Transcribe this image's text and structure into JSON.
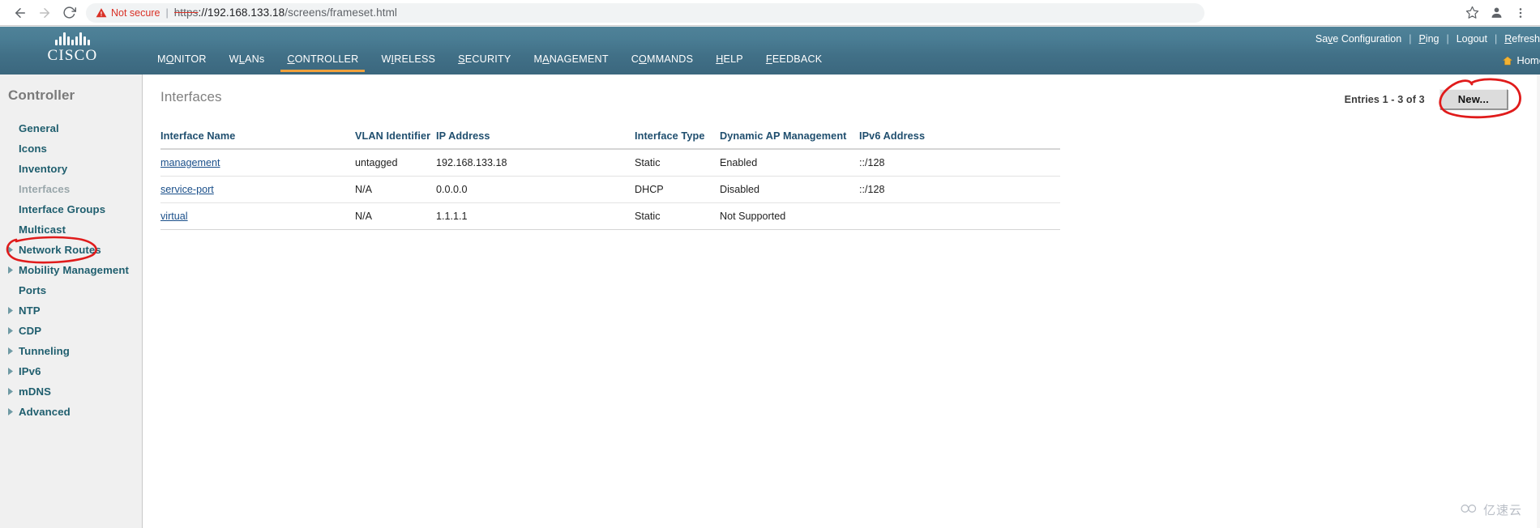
{
  "browser": {
    "back_icon": "back-arrow-icon",
    "forward_icon": "forward-arrow-icon",
    "reload_icon": "reload-icon",
    "warning_label": "Not secure",
    "separator": "|",
    "url_scheme": "https",
    "url_rest": "://192.168.133.18/screens/frameset.html",
    "url_scheme_struck": "https",
    "url_host": "://192.168.133.18",
    "url_path": "/screens/frameset.html",
    "bookmark_icon": "star-icon",
    "profile_icon": "profile-avatar-icon",
    "menu_icon": "kebab-menu-icon"
  },
  "header": {
    "brand": "CISCO",
    "nav": [
      {
        "label": "MONITOR",
        "accesskey": "O",
        "active": false
      },
      {
        "label": "WLANs",
        "accesskey": "L",
        "active": false
      },
      {
        "label": "CONTROLLER",
        "accesskey": "C",
        "active": true
      },
      {
        "label": "WIRELESS",
        "accesskey": "W",
        "active": false
      },
      {
        "label": "SECURITY",
        "accesskey": "S",
        "active": false
      },
      {
        "label": "MANAGEMENT",
        "accesskey": "A",
        "active": false
      },
      {
        "label": "COMMANDS",
        "accesskey": "O",
        "active": false
      },
      {
        "label": "HELP",
        "accesskey": "H",
        "active": false
      },
      {
        "label": "FEEDBACK",
        "accesskey": "F",
        "active": false
      }
    ],
    "links": [
      {
        "label": "Save Configuration",
        "accesskey": "v"
      },
      {
        "label": "Ping",
        "accesskey": "P"
      },
      {
        "label": "Logout",
        "accesskey": ""
      },
      {
        "label": "Refresh",
        "accesskey": "R"
      }
    ],
    "separator": "|",
    "home_label": "Home",
    "home_icon": "house-icon",
    "accent_color": "#f0a13c",
    "bar_color": "#44758c"
  },
  "sidebar": {
    "title": "Controller",
    "items": [
      {
        "label": "General",
        "expandable": false,
        "current": false
      },
      {
        "label": "Icons",
        "expandable": false,
        "current": false
      },
      {
        "label": "Inventory",
        "expandable": false,
        "current": false
      },
      {
        "label": "Interfaces",
        "expandable": false,
        "current": true
      },
      {
        "label": "Interface Groups",
        "expandable": false,
        "current": false
      },
      {
        "label": "Multicast",
        "expandable": false,
        "current": false
      },
      {
        "label": "Network Routes",
        "expandable": true,
        "current": false
      },
      {
        "label": "Mobility Management",
        "expandable": true,
        "current": false
      },
      {
        "label": "Ports",
        "expandable": false,
        "current": false
      },
      {
        "label": "NTP",
        "expandable": true,
        "current": false
      },
      {
        "label": "CDP",
        "expandable": true,
        "current": false
      },
      {
        "label": "Tunneling",
        "expandable": true,
        "current": false
      },
      {
        "label": "IPv6",
        "expandable": true,
        "current": false
      },
      {
        "label": "mDNS",
        "expandable": true,
        "current": false
      },
      {
        "label": "Advanced",
        "expandable": true,
        "current": false
      }
    ]
  },
  "main": {
    "page_title": "Interfaces",
    "entries_text": "Entries 1 - 3 of 3",
    "new_button_label": "New...",
    "annotation_color": "#e01b1b",
    "table": {
      "columns": [
        "Interface Name",
        "VLAN Identifier",
        "IP Address",
        "Interface Type",
        "Dynamic AP Management",
        "IPv6 Address"
      ],
      "rows": [
        {
          "name": "management",
          "vlan": "untagged",
          "ip": "192.168.133.18",
          "type": "Static",
          "dynamic_ap": "Enabled",
          "ipv6": "::/128"
        },
        {
          "name": "service-port",
          "vlan": "N/A",
          "ip": "0.0.0.0",
          "type": "DHCP",
          "dynamic_ap": "Disabled",
          "ipv6": "::/128"
        },
        {
          "name": "virtual",
          "vlan": "N/A",
          "ip": "1.1.1.1",
          "type": "Static",
          "dynamic_ap": "Not Supported",
          "ipv6": ""
        }
      ]
    }
  },
  "watermark": {
    "text": "亿速云",
    "icon": "cloud-icon"
  }
}
